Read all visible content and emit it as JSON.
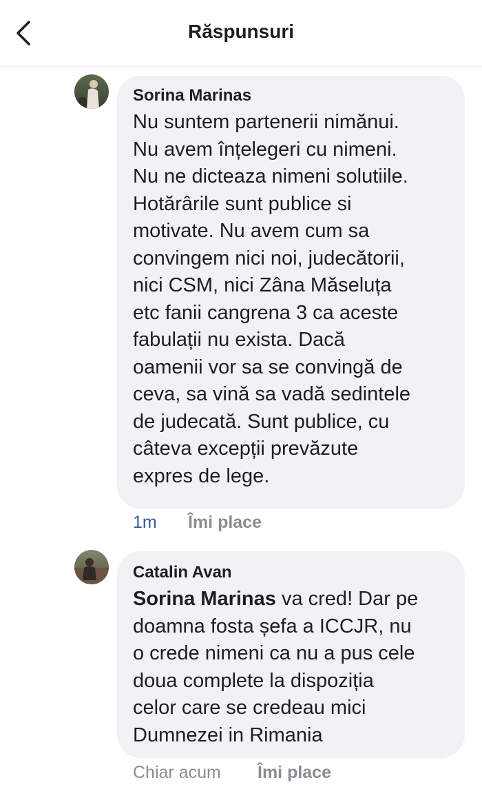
{
  "header": {
    "title": "Răspunsuri",
    "back_icon": "chevron-left-icon"
  },
  "comments": [
    {
      "author": "Sorina Marinas",
      "avatar_icon": "user-avatar",
      "lines": [
        "Nu suntem partenerii nimănui.",
        "Nu avem înțelegeri cu nimeni.",
        "Nu ne dicteaza nimeni solutiile.",
        "Hotărârile sunt publice si",
        "motivate. Nu avem cum sa",
        "convingem nici noi, judecătorii,",
        "nici CSM, nici Zâna Măseluța",
        "etc fanii cangrena 3 ca aceste",
        "fabulații nu exista. Dacă",
        "oamenii vor sa se convingă de",
        "ceva, sa vină sa vadă sedintele",
        "de judecată. Sunt publice, cu",
        "câteva excepții prevăzute",
        "expres de lege."
      ],
      "time": "1m",
      "like_label": "Îmi place"
    },
    {
      "author": "Catalin Avan",
      "avatar_icon": "user-avatar",
      "mention": "Sorina Marinas",
      "first_line_rest": " va cred! Dar pe",
      "lines": [
        "doamna fosta șefa a ICCJR, nu",
        "o crede nimeni ca nu a pus cele",
        "doua complete la dispoziția",
        "celor care se credeau mici",
        "Dumnezei in Rimania"
      ],
      "time": "Chiar acum",
      "like_label": "Îmi place"
    }
  ],
  "colors": {
    "bubble": "#f0f2f5",
    "text": "#1c1e21",
    "time_link": "#385898",
    "meta_gray": "#8a8d91"
  }
}
